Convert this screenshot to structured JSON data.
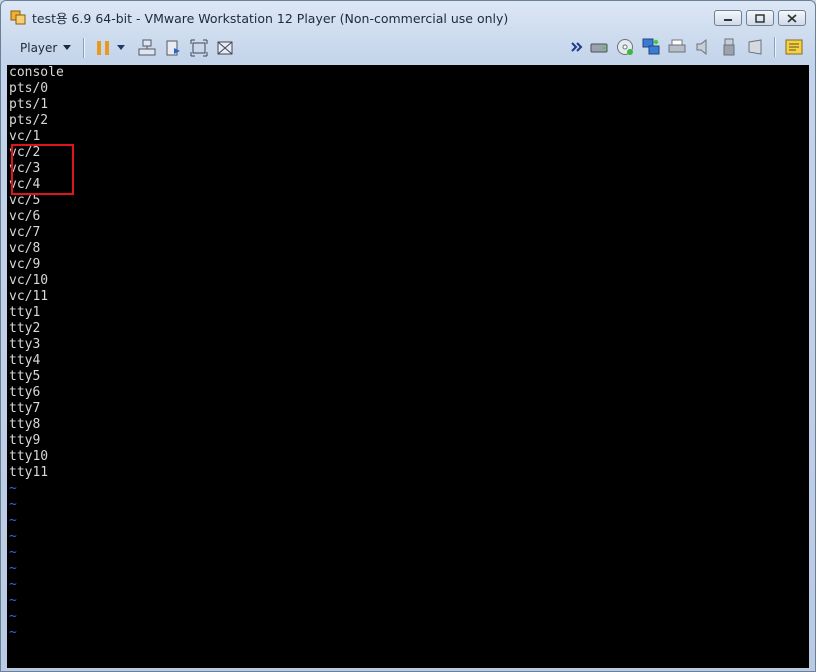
{
  "window": {
    "title": "test용 6.9 64-bit - VMware Workstation 12 Player (Non-commercial use only)"
  },
  "toolbar": {
    "player_label": "Player"
  },
  "terminal": {
    "lines": [
      "console",
      "pts/0",
      "pts/1",
      "pts/2",
      "vc/1",
      "vc/2",
      "vc/3",
      "vc/4",
      "vc/5",
      "vc/6",
      "vc/7",
      "vc/8",
      "vc/9",
      "vc/10",
      "vc/11",
      "tty1",
      "tty2",
      "tty3",
      "tty4",
      "tty5",
      "tty6",
      "tty7",
      "tty8",
      "tty9",
      "tty10",
      "tty11"
    ],
    "tildes": [
      "~",
      "~",
      "~",
      "~",
      "~",
      "~",
      "~",
      "~",
      "~",
      "~"
    ],
    "tilde_color": "#3a63d8",
    "highlight_color": "#e0141c"
  }
}
